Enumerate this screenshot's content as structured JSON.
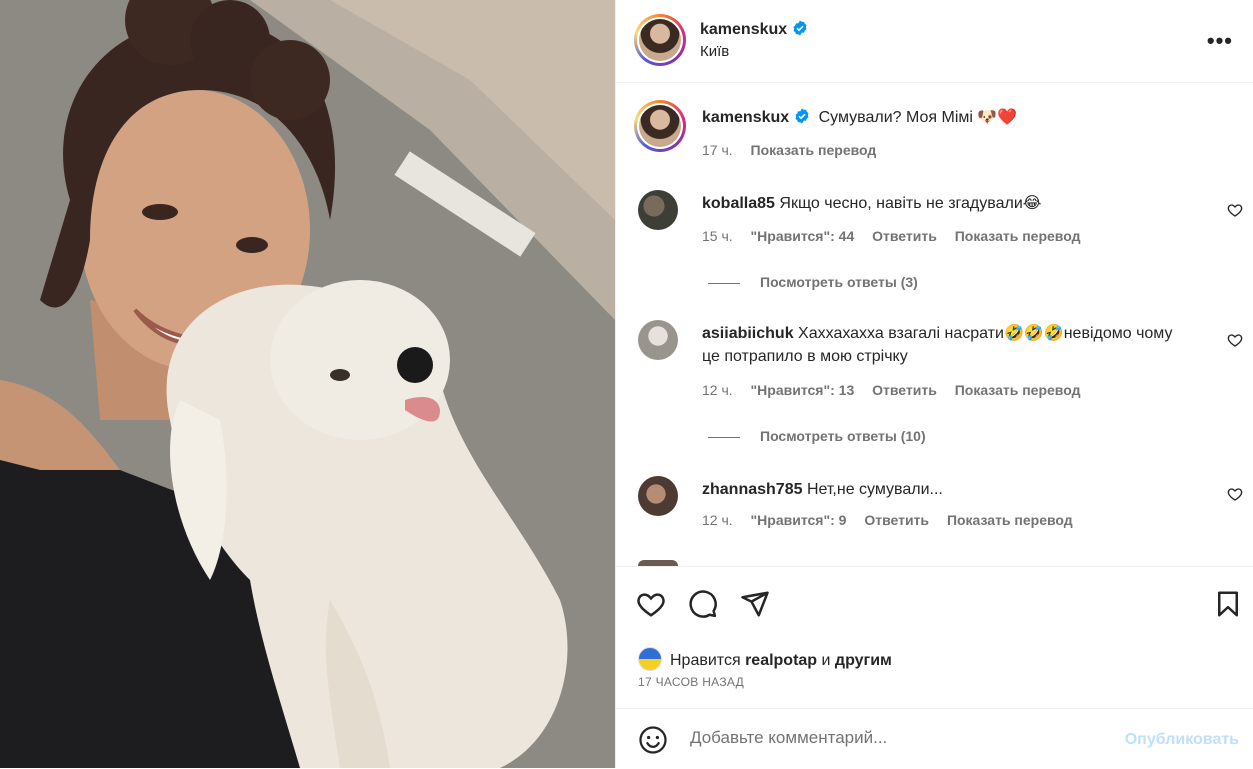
{
  "header": {
    "username": "kamenskux",
    "location": "Київ",
    "more_label": "•••"
  },
  "caption": {
    "username": "kamenskux",
    "text": "Сумували? Моя Мімі 🐶❤️",
    "time": "17 ч.",
    "translate": "Показать перевод"
  },
  "comments": [
    {
      "username": "koballa85",
      "text": "Якщо чесно, навіть не згадували😂",
      "time": "15 ч.",
      "likes": "\"Нравится\": 44",
      "reply": "Ответить",
      "translate": "Показать перевод",
      "view_replies": "Посмотреть ответы (3)"
    },
    {
      "username": "asiiabiichuk",
      "text": "Хаххахахха взагалі насрати🤣🤣🤣невідомо чому це потрапило в мою стрічку",
      "time": "12 ч.",
      "likes": "\"Нравится\": 13",
      "reply": "Ответить",
      "translate": "Показать перевод",
      "view_replies": "Посмотреть ответы (10)"
    },
    {
      "username": "zhannash785",
      "text": "Нет,не сумували...",
      "time": "12 ч.",
      "likes": "\"Нравится\": 9",
      "reply": "Ответить",
      "translate": "Показать перевод"
    }
  ],
  "liked_by": {
    "prefix": "Нравится",
    "user": "realpotap",
    "and": "и",
    "others": "другим"
  },
  "post_time": "17 ЧАСОВ НАЗАД",
  "add_comment": {
    "placeholder": "Добавьте комментарий...",
    "publish": "Опубликовать"
  },
  "colors": {
    "verified": "#0095f6",
    "publish_disabled": "#c0dffd",
    "secondary_text": "#737373"
  },
  "icons": [
    "verified-badge-icon",
    "more-icon",
    "heart-icon",
    "comment-icon",
    "share-icon",
    "bookmark-icon",
    "emoji-icon"
  ]
}
